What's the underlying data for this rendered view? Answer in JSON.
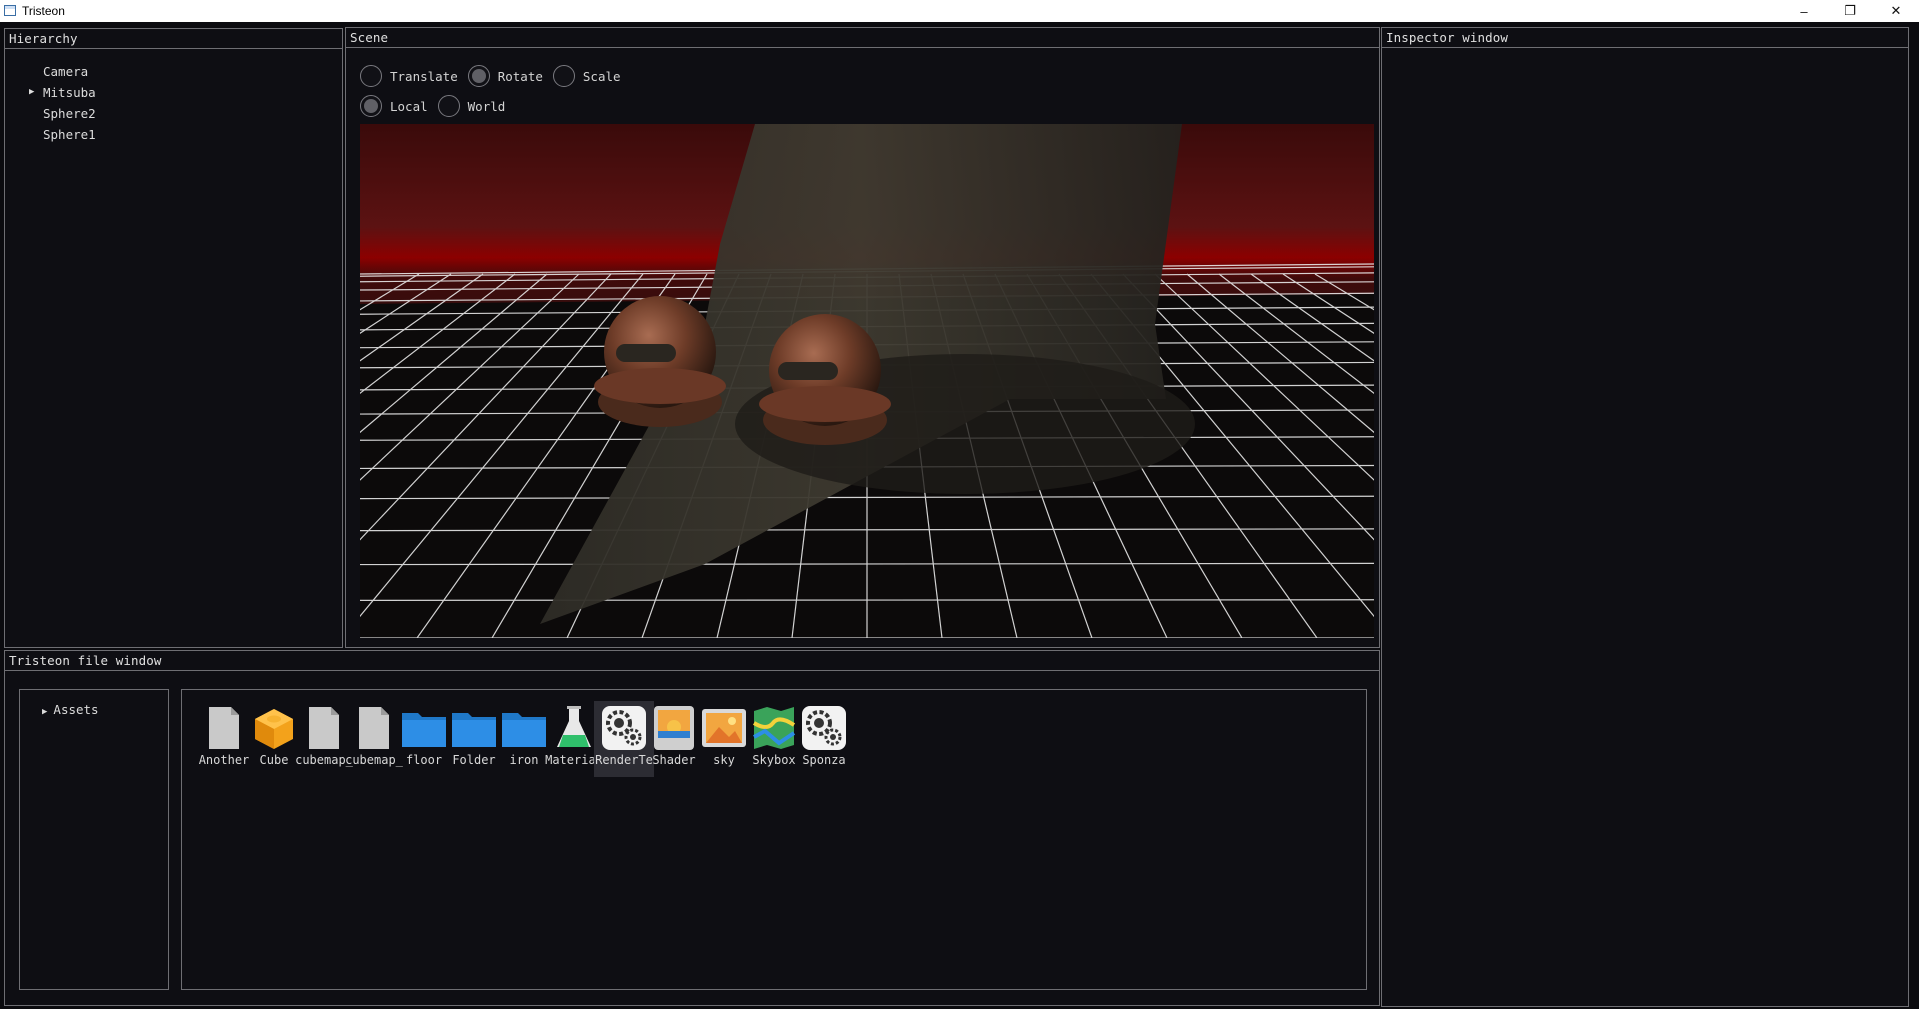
{
  "window": {
    "title": "Tristeon",
    "controls": {
      "minimize": "–",
      "restore": "❐",
      "close": "✕"
    }
  },
  "hierarchy": {
    "title": "Hierarchy",
    "items": [
      {
        "label": "Camera",
        "expandable": false
      },
      {
        "label": "Mitsuba",
        "expandable": true,
        "arrow": "▶"
      },
      {
        "label": "Sphere2",
        "expandable": false
      },
      {
        "label": "Sphere1",
        "expandable": false
      }
    ]
  },
  "scene": {
    "title": "Scene",
    "gizmo_modes": [
      {
        "label": "Translate",
        "selected": false
      },
      {
        "label": "Rotate",
        "selected": true
      },
      {
        "label": "Scale",
        "selected": false
      }
    ],
    "spaces": [
      {
        "label": "Local",
        "selected": true
      },
      {
        "label": "World",
        "selected": false
      }
    ]
  },
  "inspector": {
    "title": "Inspector window"
  },
  "file_window": {
    "title": "Tristeon file window",
    "tree": {
      "root": "Assets",
      "arrow": "▶"
    },
    "assets": [
      {
        "label": "Another",
        "icon": "file-icon"
      },
      {
        "label": "Cube",
        "icon": "cube-icon"
      },
      {
        "label": "cubemap_",
        "icon": "file-icon"
      },
      {
        "label": "cubemap_",
        "icon": "file-icon"
      },
      {
        "label": "floor",
        "icon": "folder-icon"
      },
      {
        "label": "Folder",
        "icon": "folder-icon"
      },
      {
        "label": "iron",
        "icon": "folder-icon"
      },
      {
        "label": "Material",
        "icon": "flask-icon"
      },
      {
        "label": "RenderTe",
        "icon": "gears-icon",
        "selected": true
      },
      {
        "label": "Shader",
        "icon": "shader-icon"
      },
      {
        "label": "sky",
        "icon": "image-icon"
      },
      {
        "label": "Skybox",
        "icon": "map-icon"
      },
      {
        "label": "Sponza",
        "icon": "gears-icon"
      }
    ]
  },
  "colors": {
    "background": "#0e0e13",
    "border": "#6e6e73",
    "folder": "#2d8ee6",
    "cube": "#f3a21b",
    "sky_red": "#8c0000"
  }
}
